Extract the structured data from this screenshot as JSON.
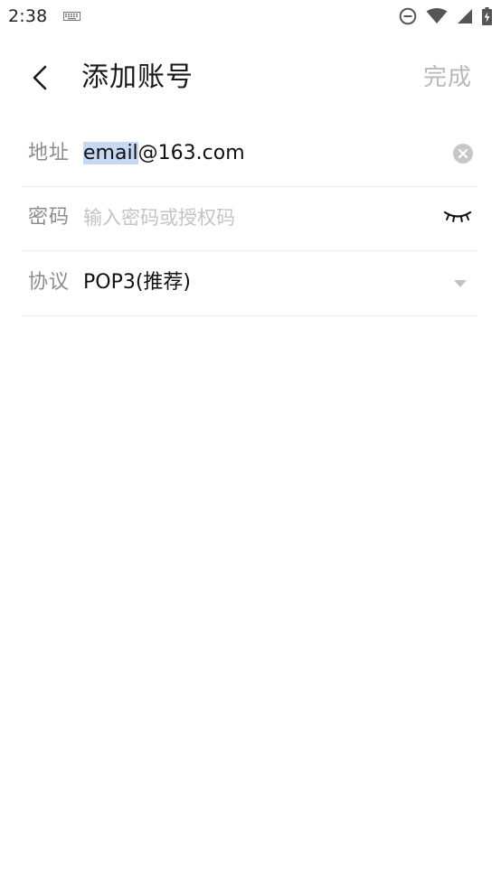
{
  "status_bar": {
    "time": "2:38",
    "icons": [
      "keyboard-icon",
      "do-not-disturb-icon",
      "wifi-icon",
      "signal-icon",
      "battery-charging-icon"
    ]
  },
  "header": {
    "back_icon": "chevron-left-icon",
    "title": "添加账号",
    "done_label": "完成"
  },
  "form": {
    "address": {
      "label": "地址",
      "value_selected": "email",
      "value_rest": "@163.com",
      "clear_icon": "clear-icon"
    },
    "password": {
      "label": "密码",
      "placeholder": "输入密码或授权码",
      "visibility_icon": "eye-closed-icon"
    },
    "protocol": {
      "label": "协议",
      "value": "POP3(推荐)",
      "dropdown_icon": "triangle-down-icon"
    }
  },
  "colors": {
    "selection": "#c6d8f3",
    "label_gray": "#8c8c8c",
    "placeholder_gray": "#c4c4c4",
    "done_gray": "#b9b9b9",
    "divider": "#ececec"
  }
}
